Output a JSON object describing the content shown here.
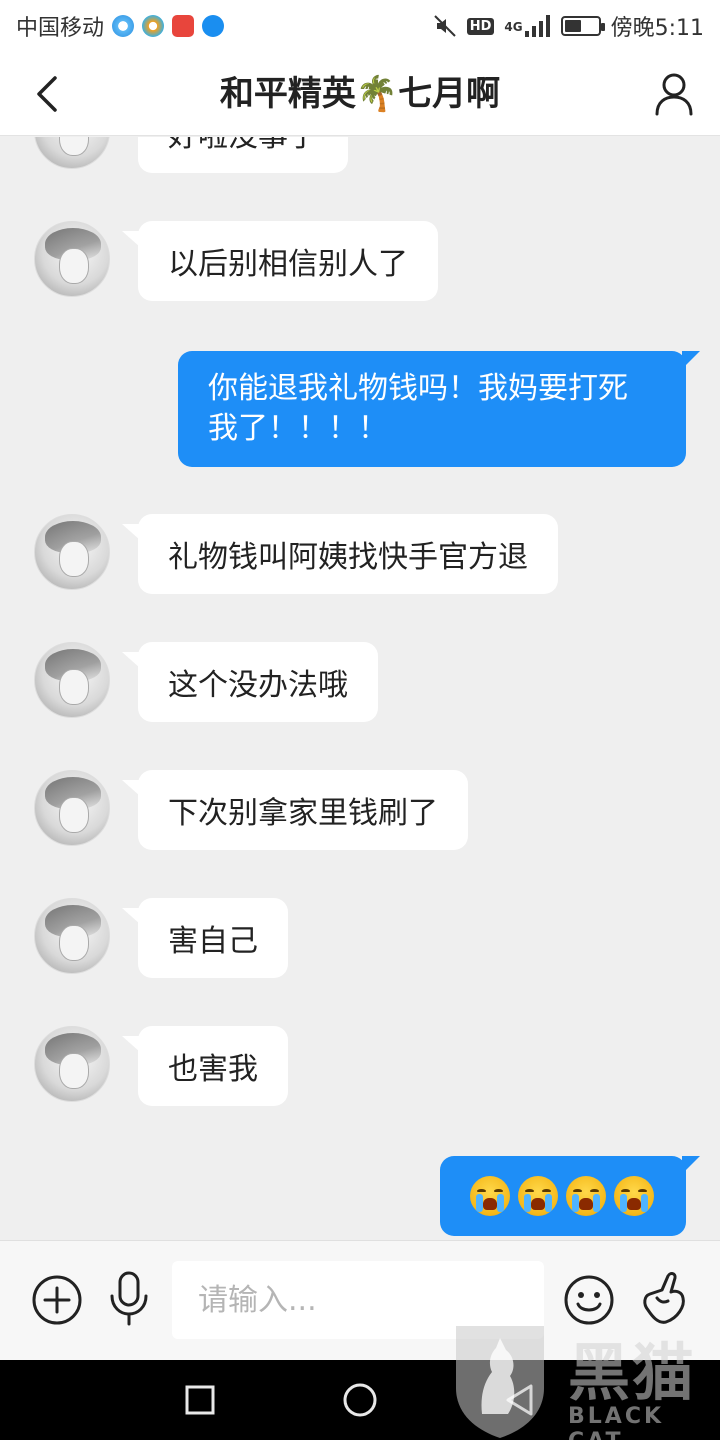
{
  "status_bar": {
    "carrier": "中国移动",
    "network": "4G",
    "hd": "HD",
    "time": "傍晚5:11",
    "battery_level": 0.5,
    "app_icons": [
      "baidu-icon",
      "weibo-icon",
      "weishi-icon",
      "alipay-icon"
    ]
  },
  "header": {
    "title": "和平精英🌴七月啊"
  },
  "chat": {
    "messages": [
      {
        "side": "left",
        "text": "好啦没事了"
      },
      {
        "side": "left",
        "text": "以后别相信别人了"
      },
      {
        "side": "right",
        "line1": "你能退我礼物钱吗！我妈要打死",
        "line2": "我了！！！！"
      },
      {
        "side": "left",
        "text": "礼物钱叫阿姨找快手官方退"
      },
      {
        "side": "left",
        "text": "这个没办法哦"
      },
      {
        "side": "left",
        "text": "下次别拿家里钱刷了"
      },
      {
        "side": "left",
        "text": "害自己"
      },
      {
        "side": "left",
        "text": "也害我"
      },
      {
        "side": "right",
        "emoji": "loudly-crying-face",
        "count": 4
      }
    ]
  },
  "input_bar": {
    "placeholder": "请输入..."
  },
  "watermark": {
    "text": "黑猫",
    "subtext": "BLACK CAT"
  },
  "colors": {
    "accent_blue": "#1e8ef7",
    "background": "#efefef",
    "bubble_left": "#ffffff"
  }
}
